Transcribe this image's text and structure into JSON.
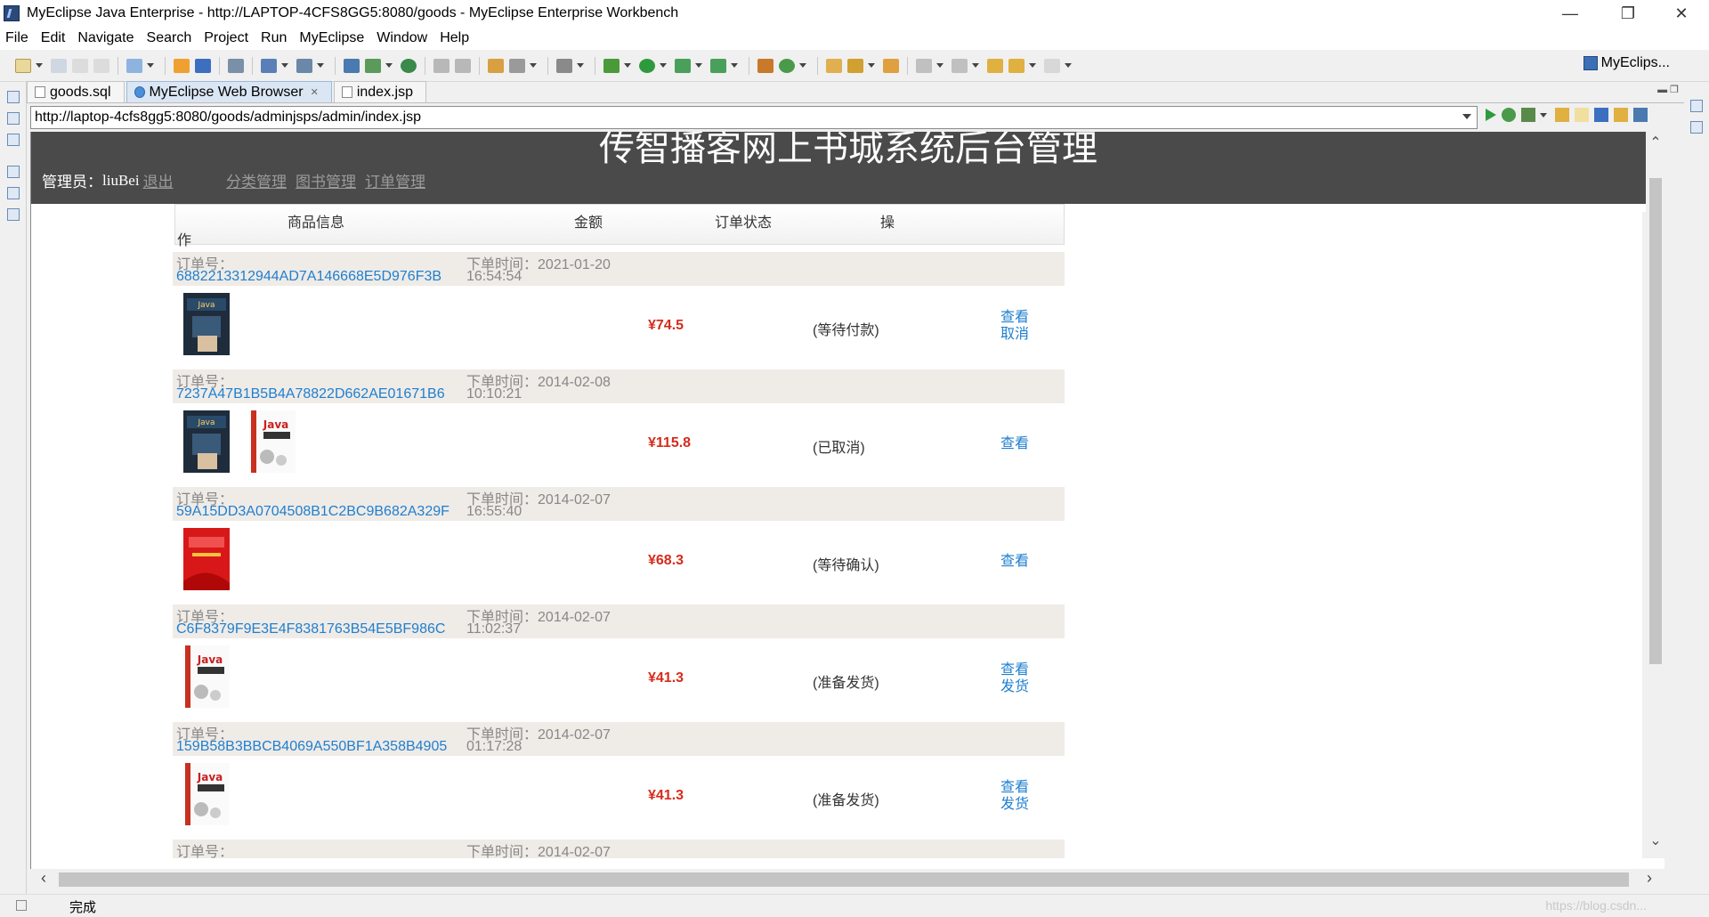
{
  "window": {
    "title": "MyEclipse Java Enterprise - http://LAPTOP-4CFS8GG5:8080/goods - MyEclipse Enterprise Workbench",
    "minimize": "—",
    "maximize": "❐",
    "close": "✕"
  },
  "menu": [
    "File",
    "Edit",
    "Navigate",
    "Search",
    "Project",
    "Run",
    "MyEclipse",
    "Window",
    "Help"
  ],
  "perspective": {
    "label": "MyEclips..."
  },
  "tabs": [
    {
      "label": "goods.sql"
    },
    {
      "label": "MyEclipse Web Browser"
    },
    {
      "label": "index.jsp"
    }
  ],
  "address": {
    "url": "http://laptop-4cfs8gg5:8080/goods/adminjsps/admin/index.jsp"
  },
  "page": {
    "title": "传智播客网上书城系统后台管理",
    "admin_label": "管理员：",
    "admin_name": "liuBei",
    "logout": "退出",
    "nav": [
      "分类管理",
      "图书管理",
      "订单管理"
    ]
  },
  "table": {
    "head": {
      "goods": "商品信息",
      "amount": "金额",
      "status": "订单状态",
      "ops1": "操",
      "ops2": "作"
    },
    "order_label": "订单号：",
    "time_label": "下单时间：",
    "orders": [
      {
        "id": "6882213312944AD7A146668E5D976F3B",
        "date": "2021-01-20",
        "time": "16:54:54",
        "price": "¥74.5",
        "status": "(等待付款)",
        "act1": "查看",
        "act2": "取消",
        "books": [
          "dark"
        ]
      },
      {
        "id": "7237A47B1B5B4A78822D662AE01671B6",
        "date": "2014-02-08",
        "time": "10:10:21",
        "price": "¥115.8",
        "status": "(已取消)",
        "act1": "查看",
        "act2": "",
        "books": [
          "dark",
          "white"
        ]
      },
      {
        "id": "59A15DD3A0704508B1C2BC9B682A329F",
        "date": "2014-02-07",
        "time": "16:55:40",
        "price": "¥68.3",
        "status": "(等待确认)",
        "act1": "查看",
        "act2": "",
        "books": [
          "red"
        ]
      },
      {
        "id": "C6F8379F9E3E4F8381763B54E5BF986C",
        "date": "2014-02-07",
        "time": "11:02:37",
        "price": "¥41.3",
        "status": "(准备发货)",
        "act1": "查看",
        "act2": "发货",
        "books": [
          "white"
        ]
      },
      {
        "id": "159B58B3BBCB4069A550BF1A358B4905",
        "date": "2014-02-07",
        "time": "01:17:28",
        "price": "¥41.3",
        "status": "(准备发货)",
        "act1": "查看",
        "act2": "发货",
        "books": [
          "white"
        ]
      },
      {
        "id": "",
        "date": "2014-02-07",
        "time": "",
        "price": "",
        "status": "",
        "act1": "",
        "act2": "",
        "books": []
      }
    ]
  },
  "statusbar": {
    "text": "完成",
    "watermark": "https://blog.csdn..."
  },
  "colors": {
    "header_bg": "#4a4a4a",
    "row_meta_bg": "#efebe7",
    "link": "#1f7fcf",
    "price": "#d62b1b"
  }
}
